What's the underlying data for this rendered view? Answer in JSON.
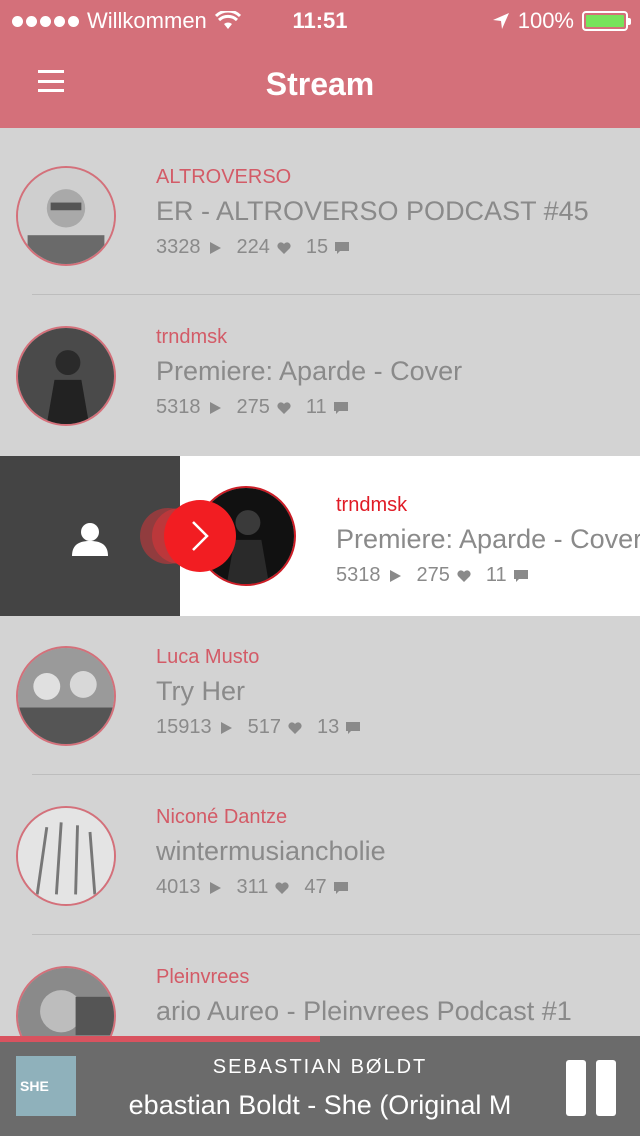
{
  "status_bar": {
    "carrier": "Willkommen",
    "time": "11:51",
    "battery": "100%",
    "battery_color": "#77e35c"
  },
  "header": {
    "title": "Stream",
    "bar_color": "#d4707a",
    "menu_icon": "hamburger-menu-icon"
  },
  "feed": [
    {
      "artist": "ALTROVERSO",
      "track": "ER - ALTROVERSO PODCAST #45",
      "plays": "3328",
      "likes": "224",
      "comments": "15"
    },
    {
      "artist": "trndmsk",
      "track": "Premiere: Aparde - Cover",
      "plays": "5318",
      "likes": "275",
      "comments": "11"
    },
    {
      "artist": "trndmsk",
      "track": "Premiere: Aparde - Cover",
      "plays": "5318",
      "likes": "275",
      "comments": "11",
      "swiped": true
    },
    {
      "artist": "Luca Musto",
      "track": "Try Her",
      "plays": "15913",
      "likes": "517",
      "comments": "13"
    },
    {
      "artist": "Niconé Dantze",
      "track": "wintermusiancholie",
      "plays": "4013",
      "likes": "311",
      "comments": "47"
    },
    {
      "artist": "Pleinvrees",
      "track": "ario Aureo - Pleinvrees Podcast #1",
      "plays": "",
      "likes": "",
      "comments": ""
    }
  ],
  "row_actions": {
    "profile_icon": "user-icon",
    "play_icon": "chevron-right-icon",
    "accent_color": "#f21d22"
  },
  "player": {
    "artist": "SEBASTIAN BØLDT",
    "track": "ebastian Boldt - She (Original M",
    "cover_text": "SHE",
    "progress": 0.5,
    "pause_icon": "pause-icon"
  }
}
